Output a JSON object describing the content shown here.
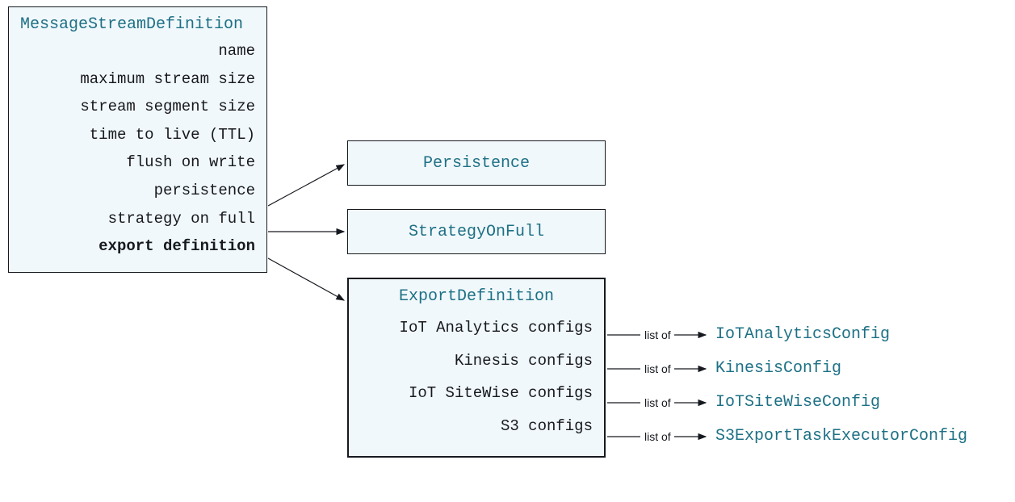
{
  "msd": {
    "title": "MessageStreamDefinition",
    "props": [
      "name",
      "maximum stream size",
      "stream segment size",
      "time to live (TTL)",
      "flush on write",
      "persistence",
      "strategy on full",
      "export definition"
    ]
  },
  "persistence": {
    "label": "Persistence"
  },
  "strategyOnFull": {
    "label": "StrategyOnFull"
  },
  "exportDef": {
    "title": "ExportDefinition",
    "props": [
      "IoT Analytics configs",
      "Kinesis configs",
      "IoT SiteWise configs",
      "S3 configs"
    ]
  },
  "listOf": "list of",
  "configs": [
    "IoTAnalyticsConfig",
    "KinesisConfig",
    "IoTSiteWiseConfig",
    "S3ExportTaskExecutorConfig"
  ]
}
